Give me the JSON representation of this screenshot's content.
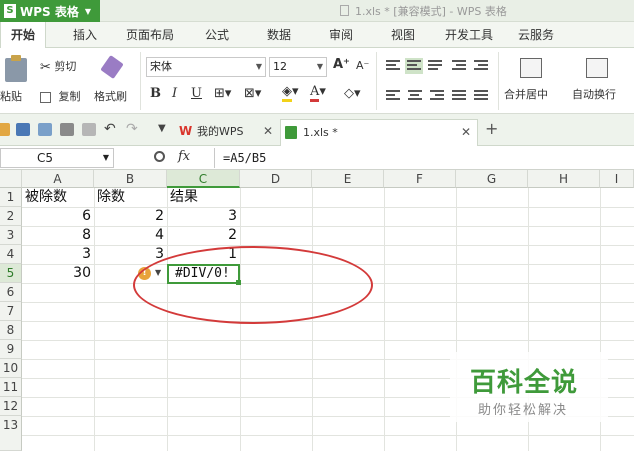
{
  "titlebar": {
    "app_name": "WPS 表格",
    "app_logo": "S",
    "document_title": "1.xls * [兼容模式] - WPS 表格"
  },
  "ribbon_tabs": [
    "开始",
    "插入",
    "页面布局",
    "公式",
    "数据",
    "审阅",
    "视图",
    "开发工具",
    "云服务"
  ],
  "ribbon": {
    "paste": "粘贴",
    "cut": "剪切",
    "copy": "复制",
    "format_painter": "格式刷",
    "font_name": "宋体",
    "font_size": "12",
    "merge_center": "合并居中",
    "wrap_text": "自动换行",
    "bold": "B",
    "italic": "I",
    "underline": "U"
  },
  "doc_tabs": [
    {
      "label": "我的WPS",
      "active": false
    },
    {
      "label": "1.xls *",
      "active": true
    }
  ],
  "formula_bar": {
    "name_box": "C5",
    "fx": "fx",
    "formula": "=A5/B5"
  },
  "columns": [
    "A",
    "B",
    "C",
    "D",
    "E",
    "F",
    "G",
    "H",
    "I"
  ],
  "rows": [
    "1",
    "2",
    "3",
    "4",
    "5",
    "6",
    "7",
    "8",
    "9",
    "10",
    "11",
    "12",
    "13"
  ],
  "cells": {
    "A1": "被除数",
    "B1": "除数",
    "C1": "结果",
    "A2": "6",
    "B2": "2",
    "C2": "3",
    "A3": "8",
    "B3": "4",
    "C3": "2",
    "A4": "3",
    "B4": "3",
    "C4": "1",
    "A5": "30",
    "C5": "#DIV/0!"
  },
  "selected_cell": "C5",
  "error_indicator": "!",
  "watermark": {
    "title": "百科全说",
    "subtitle": "助你轻松解决"
  },
  "colors": {
    "accent": "#3f9a3a",
    "annotation": "#d33a3a",
    "error_badge": "#e8a33a"
  }
}
